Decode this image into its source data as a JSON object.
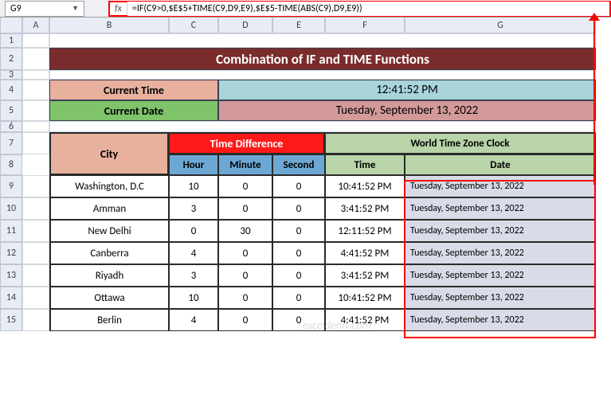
{
  "nameBox": "G9",
  "formula": "=IF(C9>0,$E$5+TIME(C9,D9,E9),$E$5-TIME(ABS(C9),D9,E9))",
  "columns": [
    "A",
    "B",
    "C",
    "D",
    "E",
    "F",
    "G"
  ],
  "rows": [
    "1",
    "2",
    "3",
    "4",
    "5",
    "6",
    "7",
    "8",
    "9",
    "10",
    "11",
    "12",
    "13",
    "14",
    "15"
  ],
  "title": "Combination of IF and TIME Functions",
  "currentTimeLabel": "Current Time",
  "currentTimeValue": "12:41:52 PM",
  "currentDateLabel": "Current Date",
  "currentDateValue": "Tuesday, September 13, 2022",
  "headers": {
    "city": "City",
    "timeDiff": "Time Difference",
    "wtzClock": "World Time Zone Clock",
    "hour": "Hour",
    "minute": "Minute",
    "second": "Second",
    "time": "Time",
    "date": "Date"
  },
  "data": [
    {
      "city": "Washington, D.C",
      "hour": "10",
      "minute": "0",
      "second": "0",
      "time": "10:41:52 PM",
      "date": "Tuesday, September 13, 2022"
    },
    {
      "city": "Amman",
      "hour": "3",
      "minute": "0",
      "second": "0",
      "time": "3:41:52 PM",
      "date": "Tuesday, September 13, 2022"
    },
    {
      "city": "New Delhi",
      "hour": "0",
      "minute": "30",
      "second": "0",
      "time": "12:11:52 PM",
      "date": "Tuesday, September 13, 2022"
    },
    {
      "city": "Canberra",
      "hour": "4",
      "minute": "0",
      "second": "0",
      "time": "4:41:52 PM",
      "date": "Tuesday, September 13, 2022"
    },
    {
      "city": "Riyadh",
      "hour": "3",
      "minute": "0",
      "second": "0",
      "time": "3:41:52 PM",
      "date": "Tuesday, September 13, 2022"
    },
    {
      "city": "Ottawa",
      "hour": "10",
      "minute": "0",
      "second": "0",
      "time": "10:41:52 PM",
      "date": "Tuesday, September 13, 2022"
    },
    {
      "city": "Berlin",
      "hour": "4",
      "minute": "0",
      "second": "0",
      "time": "4:41:52 PM",
      "date": "Tuesday, September 13, 2022"
    }
  ],
  "watermark": "exceldemy.com"
}
